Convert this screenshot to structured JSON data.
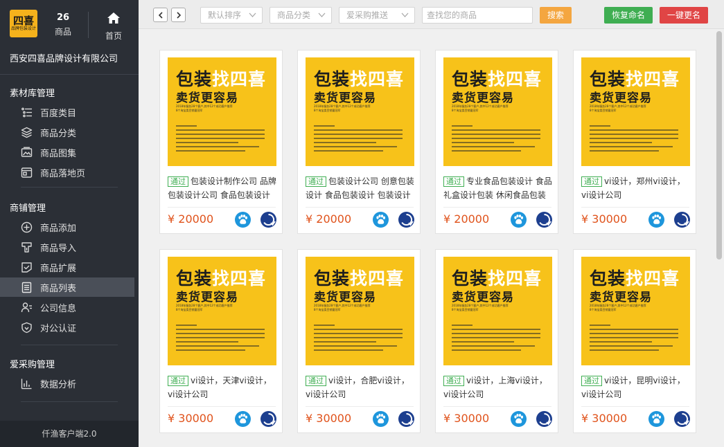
{
  "sidebar": {
    "logo_top": "四喜",
    "logo_bottom": "品牌包装设计",
    "product_count": "26",
    "product_label": "商品",
    "home_label": "首页",
    "company_name": "西安四喜品牌设计有限公司",
    "groups": [
      {
        "title": "素材库管理",
        "items": [
          {
            "label": "百度类目",
            "icon": "list-tree-icon"
          },
          {
            "label": "商品分类",
            "icon": "layers-icon"
          },
          {
            "label": "商品图集",
            "icon": "image-gallery-icon"
          },
          {
            "label": "商品落地页",
            "icon": "landing-page-icon"
          }
        ]
      },
      {
        "title": "商铺管理",
        "items": [
          {
            "label": "商品添加",
            "icon": "plus-circle-icon"
          },
          {
            "label": "商品导入",
            "icon": "import-icon"
          },
          {
            "label": "商品扩展",
            "icon": "extend-icon"
          },
          {
            "label": "商品列表",
            "icon": "list-doc-icon",
            "active": true
          },
          {
            "label": "公司信息",
            "icon": "user-info-icon"
          },
          {
            "label": "对公认证",
            "icon": "shield-icon"
          }
        ]
      },
      {
        "title": "爱采购管理",
        "items": [
          {
            "label": "数据分析",
            "icon": "bar-chart-icon"
          }
        ]
      }
    ],
    "footer": "仟渔客户端2.0"
  },
  "toolbar": {
    "sort_label": "默认排序",
    "category_label": "商品分类",
    "push_label": "爱采购推送",
    "search_placeholder": "查找您的商品",
    "search_button": "搜索",
    "restore_button": "恢复命名",
    "rename_button": "一键更名"
  },
  "poster": {
    "line1_a": "包装",
    "line1_b": "找四喜",
    "line2": "卖货更容易",
    "sub1": "2018年服务28个客户,其中12个成功客户推荐",
    "sub2": "8个淘宝类目销量冠军"
  },
  "colors": {
    "sidebar_bg": "#2b2f36",
    "poster_yellow": "#f7c21a",
    "price_orange": "#e0531c",
    "badge_green": "#3fae52",
    "search_orange": "#f4a640",
    "rename_red": "#e04545"
  },
  "products": [
    {
      "badge": "通过",
      "title": "包装设计制作公司 品牌包装设计公司 食品包装设计",
      "price": "¥ 20000"
    },
    {
      "badge": "通过",
      "title": "包装设计公司 创意包装设计 食品包装设计 包装设计",
      "price": "¥ 20000"
    },
    {
      "badge": "通过",
      "title": "专业食品包装设计 食品礼盒设计包装 休闲食品包装",
      "price": "¥ 20000"
    },
    {
      "badge": "通过",
      "title": "vi设计，郑州vi设计，vi设计公司",
      "price": "¥ 30000"
    },
    {
      "badge": "通过",
      "title": "vi设计，天津vi设计，vi设计公司",
      "price": "¥ 30000"
    },
    {
      "badge": "通过",
      "title": "vi设计，合肥vi设计，vi设计公司",
      "price": "¥ 30000"
    },
    {
      "badge": "通过",
      "title": "vi设计，上海vi设计，vi设计公司",
      "price": "¥ 30000"
    },
    {
      "badge": "通过",
      "title": "vi设计，昆明vi设计，vi设计公司",
      "price": "¥ 30000"
    }
  ]
}
